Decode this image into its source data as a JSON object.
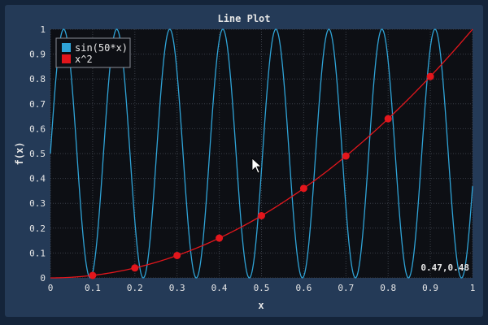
{
  "colors": {
    "background": "#14243a",
    "panel": "#243a57",
    "plot_area": "#0d0f14",
    "grid": "#3a3f48",
    "text": "#e6e6e6",
    "series_sin": "#2fa3d6",
    "series_sq": "#e3161c"
  },
  "cursor_readout": "0.47,0.48",
  "chart_data": {
    "type": "line",
    "title": "Line Plot",
    "xlabel": "x",
    "ylabel": "f(x)",
    "xlim": [
      0,
      1
    ],
    "ylim": [
      0,
      1
    ],
    "grid": true,
    "legend_position": "top-left",
    "xticks": [
      "0",
      "0.1",
      "0.2",
      "0.3",
      "0.4",
      "0.5",
      "0.6",
      "0.7",
      "0.8",
      "0.9",
      "1"
    ],
    "yticks": [
      "0",
      "0.1",
      "0.2",
      "0.3",
      "0.4",
      "0.5",
      "0.6",
      "0.7",
      "0.8",
      "0.9",
      "1"
    ],
    "series": [
      {
        "name": "sin(50*x)",
        "color": "#2fa3d6",
        "formula": "0.5 + 0.5*sin(50*x)",
        "markers": false
      },
      {
        "name": "x^2",
        "color": "#e3161c",
        "formula": "x^2",
        "markers": true,
        "points": [
          {
            "x": 0.1,
            "y": 0.01
          },
          {
            "x": 0.2,
            "y": 0.04
          },
          {
            "x": 0.3,
            "y": 0.09
          },
          {
            "x": 0.4,
            "y": 0.16
          },
          {
            "x": 0.5,
            "y": 0.25
          },
          {
            "x": 0.6,
            "y": 0.36
          },
          {
            "x": 0.7,
            "y": 0.49
          },
          {
            "x": 0.8,
            "y": 0.64
          },
          {
            "x": 0.9,
            "y": 0.81
          }
        ]
      }
    ]
  }
}
